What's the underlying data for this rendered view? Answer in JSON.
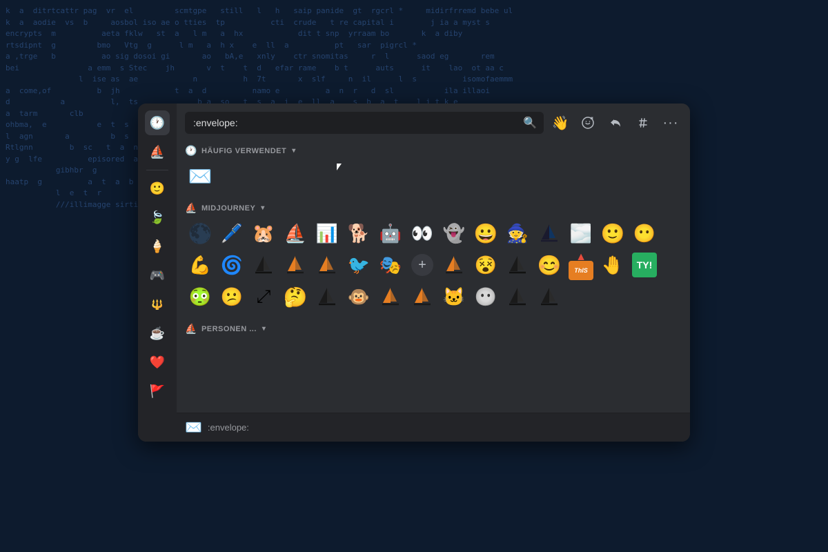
{
  "background": {
    "terminal_lines": [
      "k a  ditrtcattr pag  vr  el         scmtgpe   still   l   h   saip panide  gt  rgcrl *     midirfrremd bebe ul",
      "k a  aodie  vs  b     aosbol iso ae o tties  tp          cti  crude   t re capital i        j ia a myst s",
      "encrypts  m          aeta fklw   st  a   l m   a  hx            dit t snp  yrraam bo       k  a diby",
      "rtsdipnt  g         bmo   Vtg  g      l m   a  h x    e  ll  a          pt   sar  pigrcl *     ",
      "a ,trge   b          ao sig dosoi gi       ao   bA,e   xnly    ctr snomitas     r  l      saod eg       rem",
      "bei               a emm  s Stec    jh       v  t    t  d   efar rame    b t      auts      it    lao  ot aa c",
      "                l  ise as  ae            n          h  7t       x  slf     n  il      l  s          isomofaemmm",
      "a  come,of          b  jh            t  a  d          namo e          a  n  r   d  sl           ila illaoi",
      "d           a          l,  ts             b a  so   t  s  a  i  e  ll  a    s  b  a  t",
      "a  tarm       clb                                   ao   bA,e   xnly    ctr snomitas     r  l",
      "ohbma,  e           e  t  s  t  r        a  t  o  b  v  n  r  t  e        b t",
      "l  agn       a         b  s  t  a  l  t  e  a  s  t  n  e  p  e  r  s  o  a  t  a  b  l  s",
      "Rtlgnn        b  sc   t  a  n  d  a  s  s  t  n  d          pt   sar  pigrcl *",
      "y g  lfe          episored  a                 a serodng  g          a  t  a  b  l  s",
      "           gibhbr  g          a  t  a  b  l  s        b  e  r  a  w  s  t  e  c",
      "haatp  g          a  t  a  b  l  s        b  e  r  a  w  s  t  e  c        a  b",
      "           l  e  t  r          b  a  t  a  b  l  e  s        b  e  r  a  w  s",
      "           ///illimagge sirtie  mmebbiiaidd ssalrillbhila,/hsadvmirt  sig  aligtepolis  eo"
    ]
  },
  "picker": {
    "search_value": ":envelope:",
    "search_placeholder": ":envelope:",
    "wave_emoji": "👋",
    "top_actions": [
      {
        "id": "add-emoji",
        "symbol": "🙂",
        "label": "Add Emoji"
      },
      {
        "id": "reply",
        "symbol": "↩",
        "label": "Reply"
      },
      {
        "id": "hashtag",
        "symbol": "#",
        "label": "Channel"
      },
      {
        "id": "more",
        "symbol": "…",
        "label": "More"
      }
    ],
    "sidebar_icons": [
      {
        "id": "recent",
        "symbol": "🕐",
        "label": "Recent"
      },
      {
        "id": "sailboat",
        "symbol": "⛵",
        "label": "Sailboat"
      },
      {
        "id": "emoji",
        "symbol": "🙂",
        "label": "Emoji"
      },
      {
        "id": "leaf",
        "symbol": "🍃",
        "label": "Leaf"
      },
      {
        "id": "popsicle",
        "symbol": "🍦",
        "label": "Popsicle"
      },
      {
        "id": "gamepad",
        "symbol": "🎮",
        "label": "Gamepad"
      },
      {
        "id": "submarine",
        "symbol": "🔱",
        "label": "Submarine"
      },
      {
        "id": "coffee",
        "symbol": "☕",
        "label": "Coffee"
      },
      {
        "id": "heart",
        "symbol": "❤️",
        "label": "Heart"
      },
      {
        "id": "flag",
        "symbol": "🚩",
        "label": "Flag"
      }
    ],
    "sections": [
      {
        "id": "haufig",
        "label": "HÄUFIG VERWENDET",
        "icon": "🕐",
        "emojis": [
          {
            "id": "envelope",
            "type": "unicode",
            "symbol": "✉️",
            "label": "envelope"
          }
        ]
      },
      {
        "id": "midjourney",
        "label": "MIDJOURNEY",
        "icon": "⛵",
        "emojis": [
          {
            "id": "mj1",
            "type": "custom",
            "color": "#8B4513",
            "symbol": "🌑",
            "label": "planet"
          },
          {
            "id": "mj2",
            "type": "custom",
            "color": "#2c2c2c",
            "symbol": "🖊️",
            "label": "pencil"
          },
          {
            "id": "mj3",
            "type": "custom",
            "color": "#8B7355",
            "symbol": "🐹",
            "label": "hamster"
          },
          {
            "id": "mj4",
            "type": "sail",
            "symbol": "⛵",
            "label": "sailboat-blue"
          },
          {
            "id": "mj5",
            "type": "custom",
            "color": "#4a7c4e",
            "symbol": "📊",
            "label": "chart"
          },
          {
            "id": "mj6",
            "type": "custom",
            "color": "#c8a84b",
            "symbol": "😾",
            "label": "doge"
          },
          {
            "id": "mj7",
            "type": "custom",
            "color": "#4a4a4a",
            "symbol": "🤖",
            "label": "robot"
          },
          {
            "id": "mj8",
            "type": "custom",
            "color": "#2c2c2c",
            "symbol": "👀",
            "label": "eyes"
          },
          {
            "id": "mj9",
            "type": "custom",
            "color": "#f0f0f0",
            "symbol": "👻",
            "label": "ghost"
          },
          {
            "id": "mj10",
            "type": "custom",
            "color": "#e67e22",
            "symbol": "😀",
            "label": "happy"
          },
          {
            "id": "mj11",
            "type": "custom",
            "color": "#3a5a9c",
            "symbol": "🧙",
            "label": "wizard"
          },
          {
            "id": "mj12",
            "type": "sail",
            "symbol": "⛵",
            "label": "sailboat-dark"
          },
          {
            "id": "mj13",
            "type": "custom",
            "color": "#7a7a7a",
            "symbol": "🌫️",
            "label": "fog"
          },
          {
            "id": "mj14",
            "type": "custom",
            "color": "#f5e642",
            "symbol": "🙂",
            "label": "smile"
          },
          {
            "id": "mj15",
            "type": "custom",
            "color": "#d4a574",
            "symbol": "😶",
            "label": "face"
          },
          {
            "id": "mj16",
            "type": "custom",
            "color": "#8B6914",
            "symbol": "💪",
            "label": "muscular"
          },
          {
            "id": "mj17",
            "type": "custom",
            "color": "#4a4a4a",
            "symbol": "👁️",
            "label": "eye-spin"
          },
          {
            "id": "mj18",
            "type": "sail",
            "symbol": "⛵",
            "label": "sailboat-black"
          },
          {
            "id": "mj19",
            "type": "sail-orange",
            "symbol": "⛵",
            "label": "sailboat-orange1"
          },
          {
            "id": "mj20",
            "type": "sail-orange",
            "symbol": "⛵",
            "label": "sailboat-orange2"
          },
          {
            "id": "mj21",
            "type": "custom",
            "color": "#2c2c2c",
            "symbol": "🦅",
            "label": "bird-mask"
          },
          {
            "id": "mj22",
            "type": "custom",
            "color": "#3d3d3d",
            "symbol": "🎭",
            "label": "mask"
          },
          {
            "id": "mj23",
            "type": "plus",
            "symbol": "+",
            "label": "add"
          },
          {
            "id": "mj24",
            "type": "sail-orange",
            "symbol": "⛵",
            "label": "sailboat-orange3"
          },
          {
            "id": "mj25",
            "type": "custom",
            "color": "#4a4a4a",
            "symbol": "🌀",
            "label": "eyes2"
          },
          {
            "id": "mj26",
            "type": "sail",
            "symbol": "⛵",
            "label": "sailboat-black2"
          },
          {
            "id": "mj27",
            "type": "custom",
            "color": "#f39c12",
            "symbol": "😊",
            "label": "happy2"
          },
          {
            "id": "mj28",
            "type": "this",
            "symbol": "THIS",
            "label": "this"
          },
          {
            "id": "mj29",
            "type": "custom",
            "color": "#5a8a4a",
            "symbol": "🤚",
            "label": "hand"
          },
          {
            "id": "mj30",
            "type": "ty",
            "symbol": "TY!",
            "label": "ty"
          },
          {
            "id": "mj31",
            "type": "custom",
            "color": "#a0a0a0",
            "symbol": "😐",
            "label": "blush"
          },
          {
            "id": "mj32",
            "type": "custom",
            "color": "#c8c84a",
            "symbol": "😕",
            "label": "sad-yellow"
          },
          {
            "id": "mj33",
            "type": "custom",
            "color": "#2c2c2c",
            "symbol": "⤢",
            "label": "expand"
          },
          {
            "id": "mj34",
            "type": "custom",
            "color": "#e0c060",
            "symbol": "🤔",
            "label": "think"
          },
          {
            "id": "mj35",
            "type": "sail",
            "symbol": "⛵",
            "label": "sailboat-black3"
          },
          {
            "id": "mj36",
            "type": "custom",
            "color": "#8B7355",
            "symbol": "🐵",
            "label": "monkey"
          },
          {
            "id": "mj37",
            "type": "sail-orange",
            "symbol": "⛵",
            "label": "sailboat-orange4"
          },
          {
            "id": "mj38",
            "type": "sail-orange",
            "symbol": "⛵",
            "label": "sailboat-orange5"
          },
          {
            "id": "mj39",
            "type": "custom",
            "color": "#d0d0d0",
            "symbol": "🐱",
            "label": "white-cat"
          },
          {
            "id": "mj40",
            "type": "custom",
            "color": "#d0d0d0",
            "symbol": "😶",
            "label": "blob"
          },
          {
            "id": "mj41",
            "type": "sail",
            "symbol": "⛵",
            "label": "sailboat-black4"
          },
          {
            "id": "mj42",
            "type": "sail",
            "symbol": "⛵",
            "label": "sailboat-black5"
          }
        ]
      },
      {
        "id": "personen",
        "label": "PERSONEN ...",
        "icon": "⛵",
        "emojis": []
      }
    ],
    "bottom_bar": {
      "icon": "✉️",
      "label": ":envelope:"
    }
  }
}
